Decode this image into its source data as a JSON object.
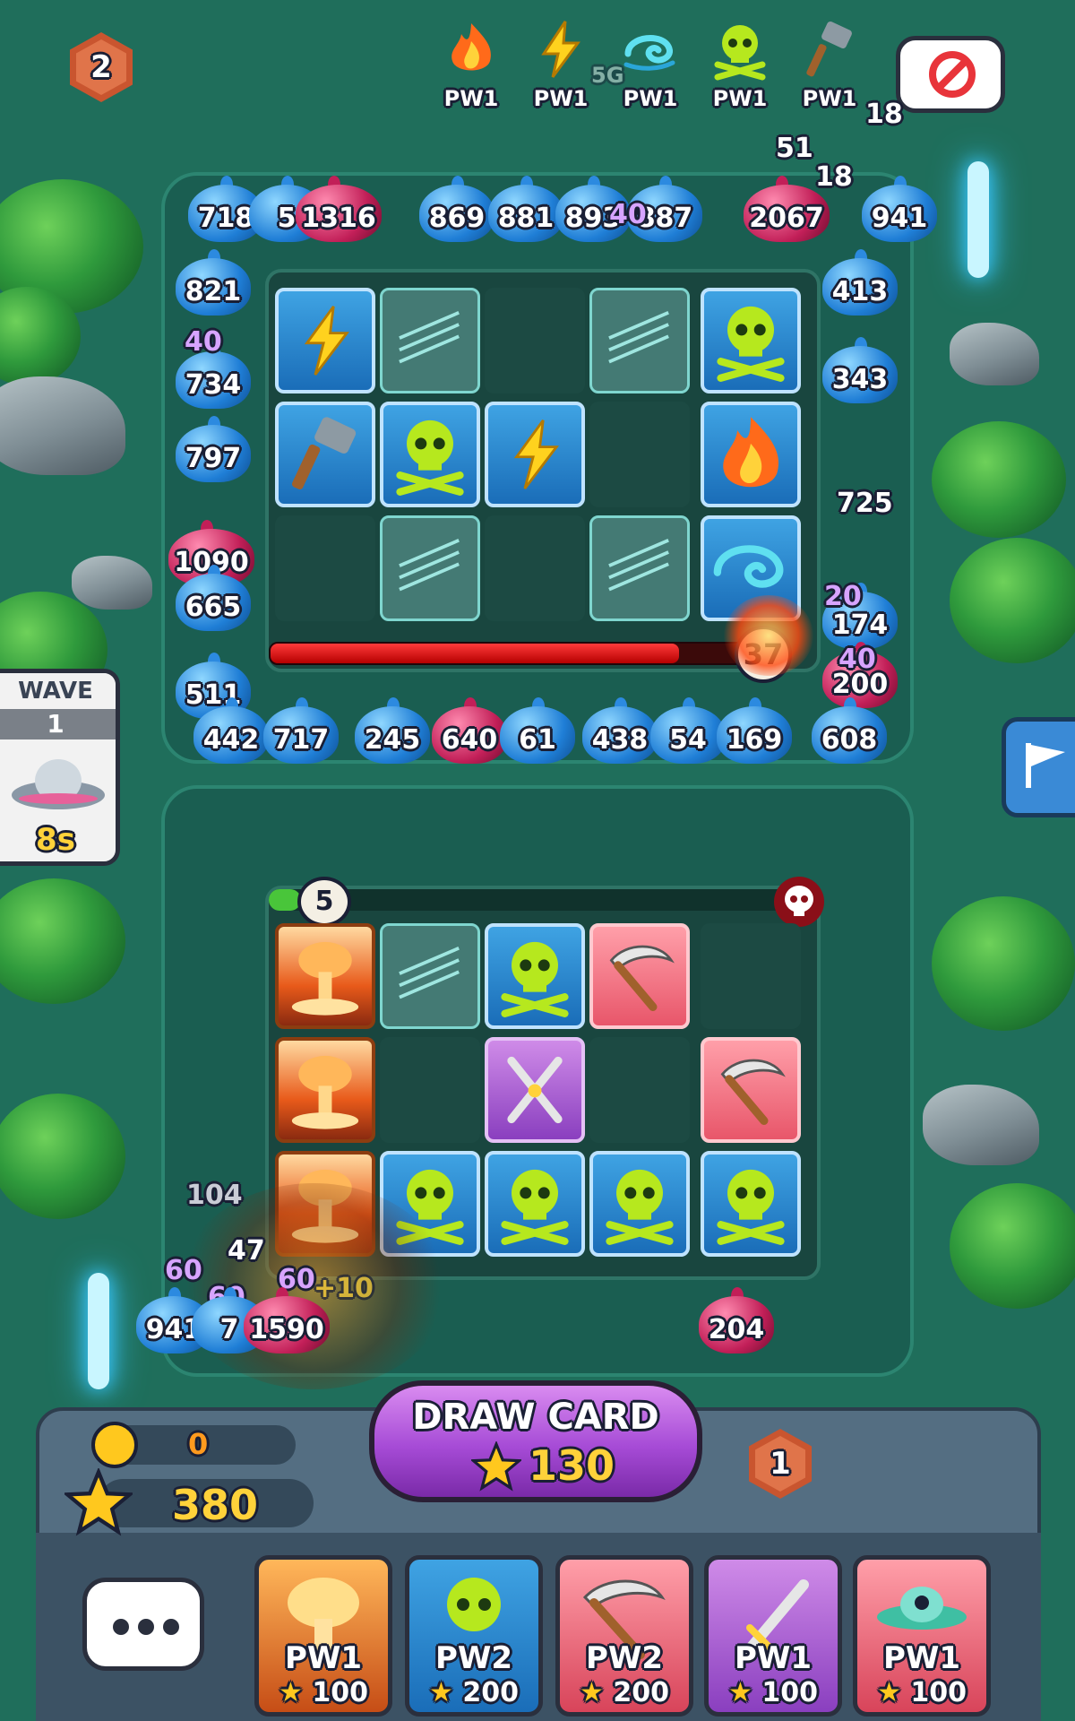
{
  "hud": {
    "level_badge": "2",
    "close_badge_label": "",
    "power_ups": [
      {
        "icon": "fire-icon",
        "label": "PW1"
      },
      {
        "icon": "lightning-icon",
        "label": "PW1"
      },
      {
        "icon": "wind-icon",
        "label": "PW1"
      },
      {
        "icon": "skull-icon",
        "label": "PW1"
      },
      {
        "icon": "hammer-icon",
        "label": "PW1"
      }
    ]
  },
  "wave": {
    "label": "WAVE",
    "number": "1",
    "timer": "8s"
  },
  "opponent_board": {
    "slimes_top": [
      "718",
      "5",
      "1316",
      "869",
      "881",
      "893",
      "887",
      "2067",
      "941"
    ],
    "slimes_left": [
      "821",
      "734",
      "797",
      "1090",
      "665",
      "511"
    ],
    "slimes_right": [
      "413",
      "343",
      "174",
      "200"
    ],
    "slimes_bottom": [
      "442",
      "717",
      "245",
      "640",
      "61",
      "438",
      "54",
      "169",
      "608"
    ],
    "floating_numbers": [
      "18",
      "51",
      "18",
      "40",
      "40",
      "725",
      "20",
      "40",
      "5G"
    ],
    "boss_hp": "37"
  },
  "player_board": {
    "skull_counter": "5",
    "floating_numbers": [
      "104",
      "60",
      "47",
      "60",
      "60",
      "+10"
    ],
    "slimes": [
      "941",
      "7",
      "1590",
      "204"
    ]
  },
  "economy": {
    "coins": "0",
    "stars": "380",
    "draw_card_label": "DRAW CARD",
    "draw_card_cost": "130",
    "rank_badge": "1"
  },
  "cards": [
    {
      "name": "nuke",
      "pw": "PW1",
      "cost": "100"
    },
    {
      "name": "skull",
      "pw": "PW2",
      "cost": "200"
    },
    {
      "name": "scythe",
      "pw": "PW2",
      "cost": "200"
    },
    {
      "name": "swords",
      "pw": "PW1",
      "cost": "100"
    },
    {
      "name": "ufo",
      "pw": "PW1",
      "cost": "100"
    }
  ],
  "colors": {
    "background": "#1f6e5b",
    "accent_purple": "#a64bd6",
    "star_gold": "#ffc81e"
  }
}
